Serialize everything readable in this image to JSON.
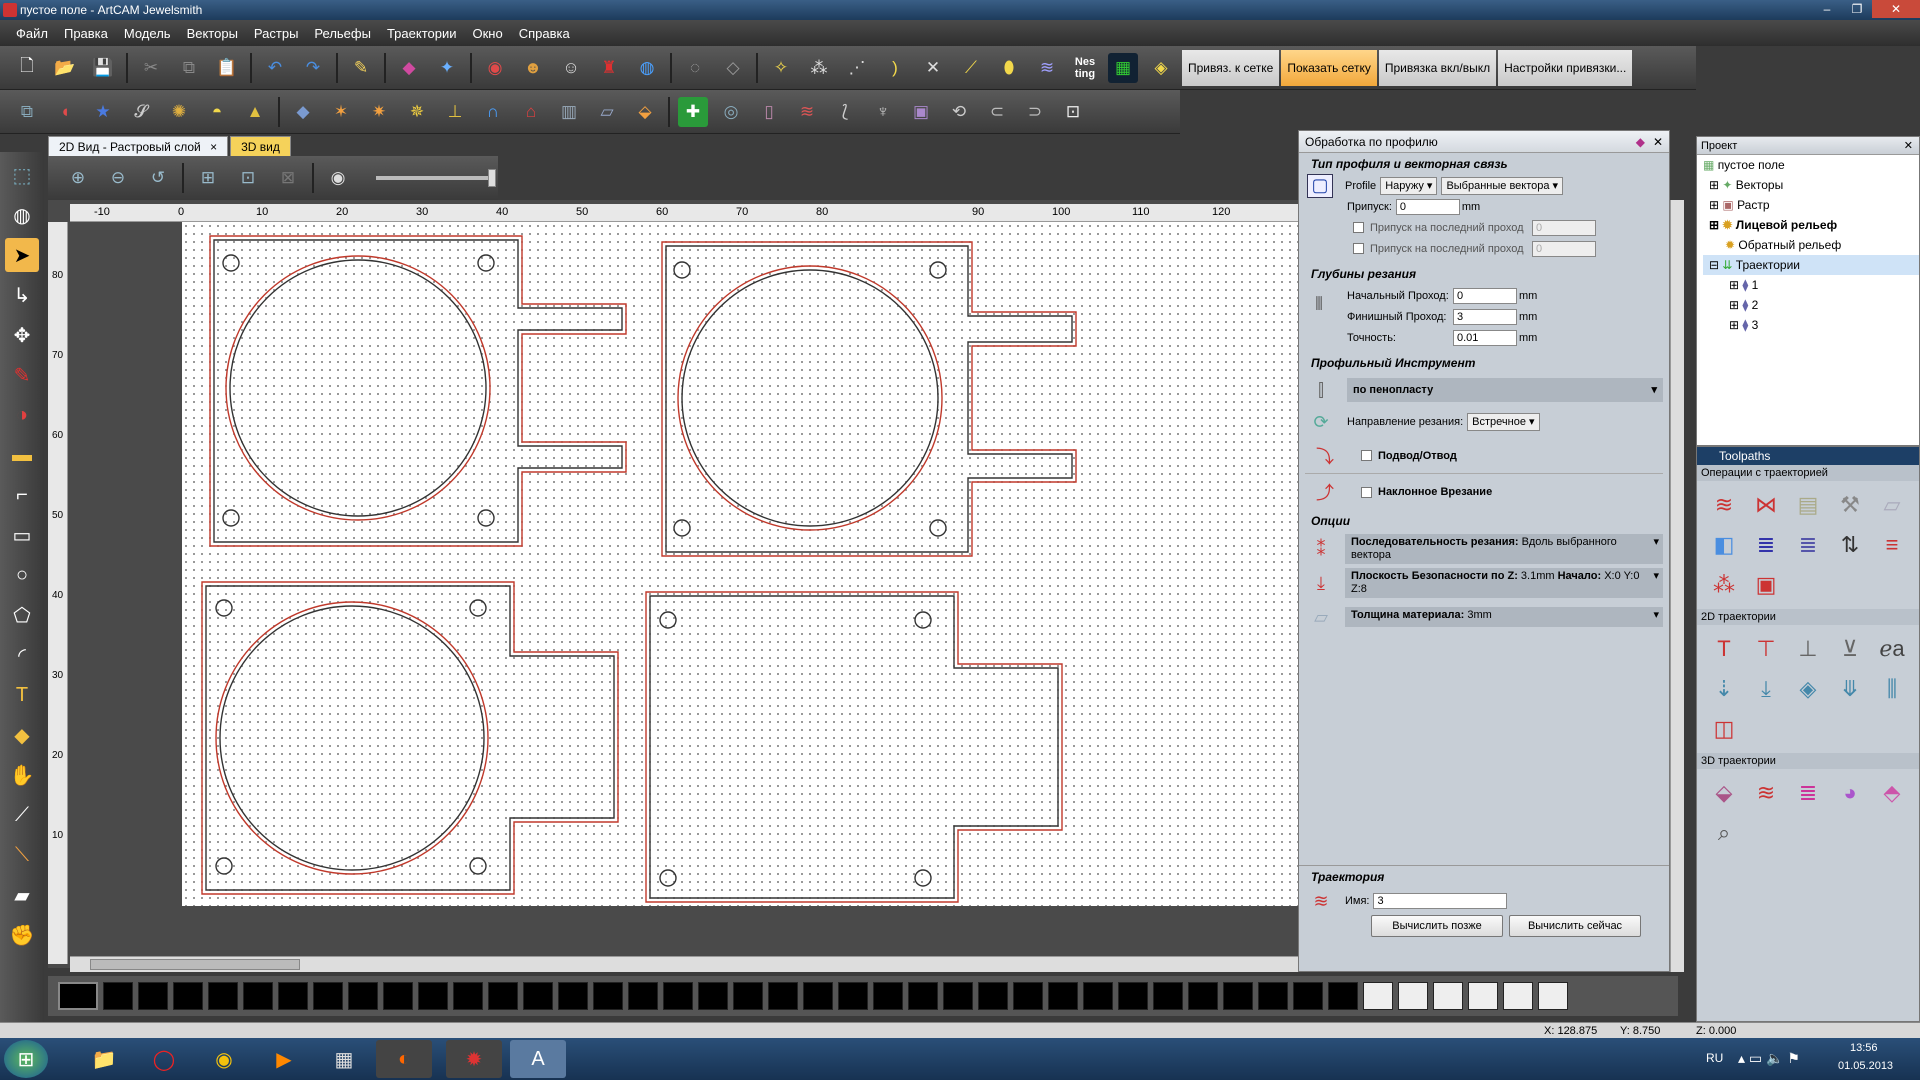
{
  "window": {
    "title": "пустое поле - ArtCAM Jewelsmith"
  },
  "menu": [
    "Файл",
    "Правка",
    "Модель",
    "Векторы",
    "Растры",
    "Рельефы",
    "Траектории",
    "Окно",
    "Справка"
  ],
  "snap_labels": {
    "snap_grid": "Привяз. к сетке",
    "show_grid": "Показать сетку",
    "snap_toggle": "Привязка вкл/выкл",
    "snap_settings": "Настройки привязки..."
  },
  "tabs": {
    "view2d": "2D Вид - Растровый слой",
    "view3d": "3D вид",
    "close": "×"
  },
  "ruler": {
    "h_ticks": [
      "-10",
      "0",
      "10",
      "20",
      "30",
      "40",
      "50",
      "60",
      "70",
      "80",
      "90",
      "100",
      "110",
      "120",
      "130"
    ],
    "v_ticks": [
      "80",
      "70",
      "60",
      "50",
      "40",
      "30",
      "20",
      "10"
    ]
  },
  "profile_panel": {
    "title": "Обработка по профилю",
    "sec_type": "Тип профиля и векторная связь",
    "profile_label": "Profile",
    "profile_side": "Наружу",
    "profile_vectors": "Выбранные вектора",
    "allowance_label": "Припуск:",
    "allowance_value": "0",
    "unit": "mm",
    "last_pass_1": "Припуск на последний проход",
    "last_pass_2": "Припуск на последний проход",
    "last_pass_value": "0",
    "sec_depth": "Глубины резания",
    "start_pass_label": "Начальный Проход:",
    "start_pass_value": "0",
    "finish_pass_label": "Финишный Проход:",
    "finish_pass_value": "3",
    "tolerance_label": "Точность:",
    "tolerance_value": "0.01",
    "sec_tool": "Профильный Инструмент",
    "tool_name": "по пенопласту",
    "direction_label": "Направление резания:",
    "direction_value": "Встречное",
    "lead_inout": "Подвод/Отвод",
    "ramp": "Наклонное Врезание",
    "sec_options": "Опции",
    "order_label": "Последовательность резания:",
    "order_value": "Вдоль выбранного вектора",
    "safez_label": "Плоскость Безопасности по Z:",
    "safez_value": "3.1mm",
    "home_label": "Начало:",
    "home_value": "X:0 Y:0 Z:8",
    "thickness_label": "Толщина материала:",
    "thickness_value": "3mm",
    "sec_toolpath": "Траектория",
    "name_label": "Имя:",
    "name_value": "3",
    "calc_later": "Вычислить позже",
    "calc_now": "Вычислить сейчас"
  },
  "project_panel": {
    "title": "Проект",
    "items": {
      "root": "пустое поле",
      "vectors": "Векторы",
      "raster": "Растр",
      "front_relief": "Лицевой рельеф",
      "back_relief": "Обратный рельеф",
      "toolpaths": "Траектории",
      "tp1": "1",
      "tp2": "2",
      "tp3": "3"
    }
  },
  "toolpaths_panel": {
    "title": "Toolpaths",
    "sec_ops": "Операции с траекторией",
    "sec_2d": "2D траектории",
    "sec_3d": "3D траектории"
  },
  "status": {
    "x": "X: 128.875",
    "y": "Y: 8.750",
    "z": "Z: 0.000"
  },
  "taskbar": {
    "lang": "RU",
    "time": "13:56",
    "date": "01.05.2013"
  },
  "colors": {
    "accent": "#f2a83b",
    "toolpath": "#c0392b",
    "panel": "#c7ced6"
  }
}
